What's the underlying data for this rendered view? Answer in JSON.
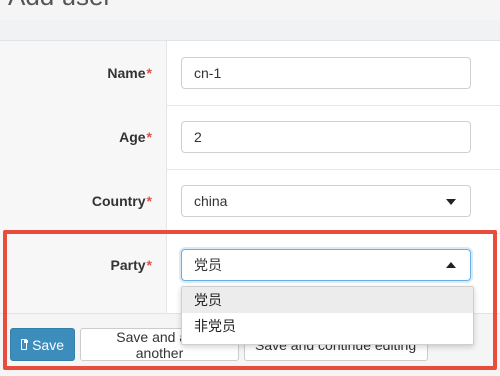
{
  "page": {
    "title": "Add user"
  },
  "form": {
    "name": {
      "label": "Name",
      "required_mark": "*",
      "value": "cn-1"
    },
    "age": {
      "label": "Age",
      "required_mark": "*",
      "value": "2"
    },
    "country": {
      "label": "Country",
      "required_mark": "*",
      "value": "china"
    },
    "party": {
      "label": "Party",
      "required_mark": "*",
      "value": "党员",
      "options": [
        "党员",
        "非党员"
      ],
      "dropdown_open": true
    }
  },
  "actions": {
    "save": "Save",
    "save_add_another": "Save and add another",
    "save_continue": "Save and continue editing"
  },
  "colors": {
    "primary": "#3c8dbc",
    "required": "#d9534f",
    "highlight": "#e74c3c"
  },
  "icons": {
    "save": "floppy-disk-icon",
    "select_closed": "caret-down-icon",
    "select_open": "caret-up-icon"
  }
}
